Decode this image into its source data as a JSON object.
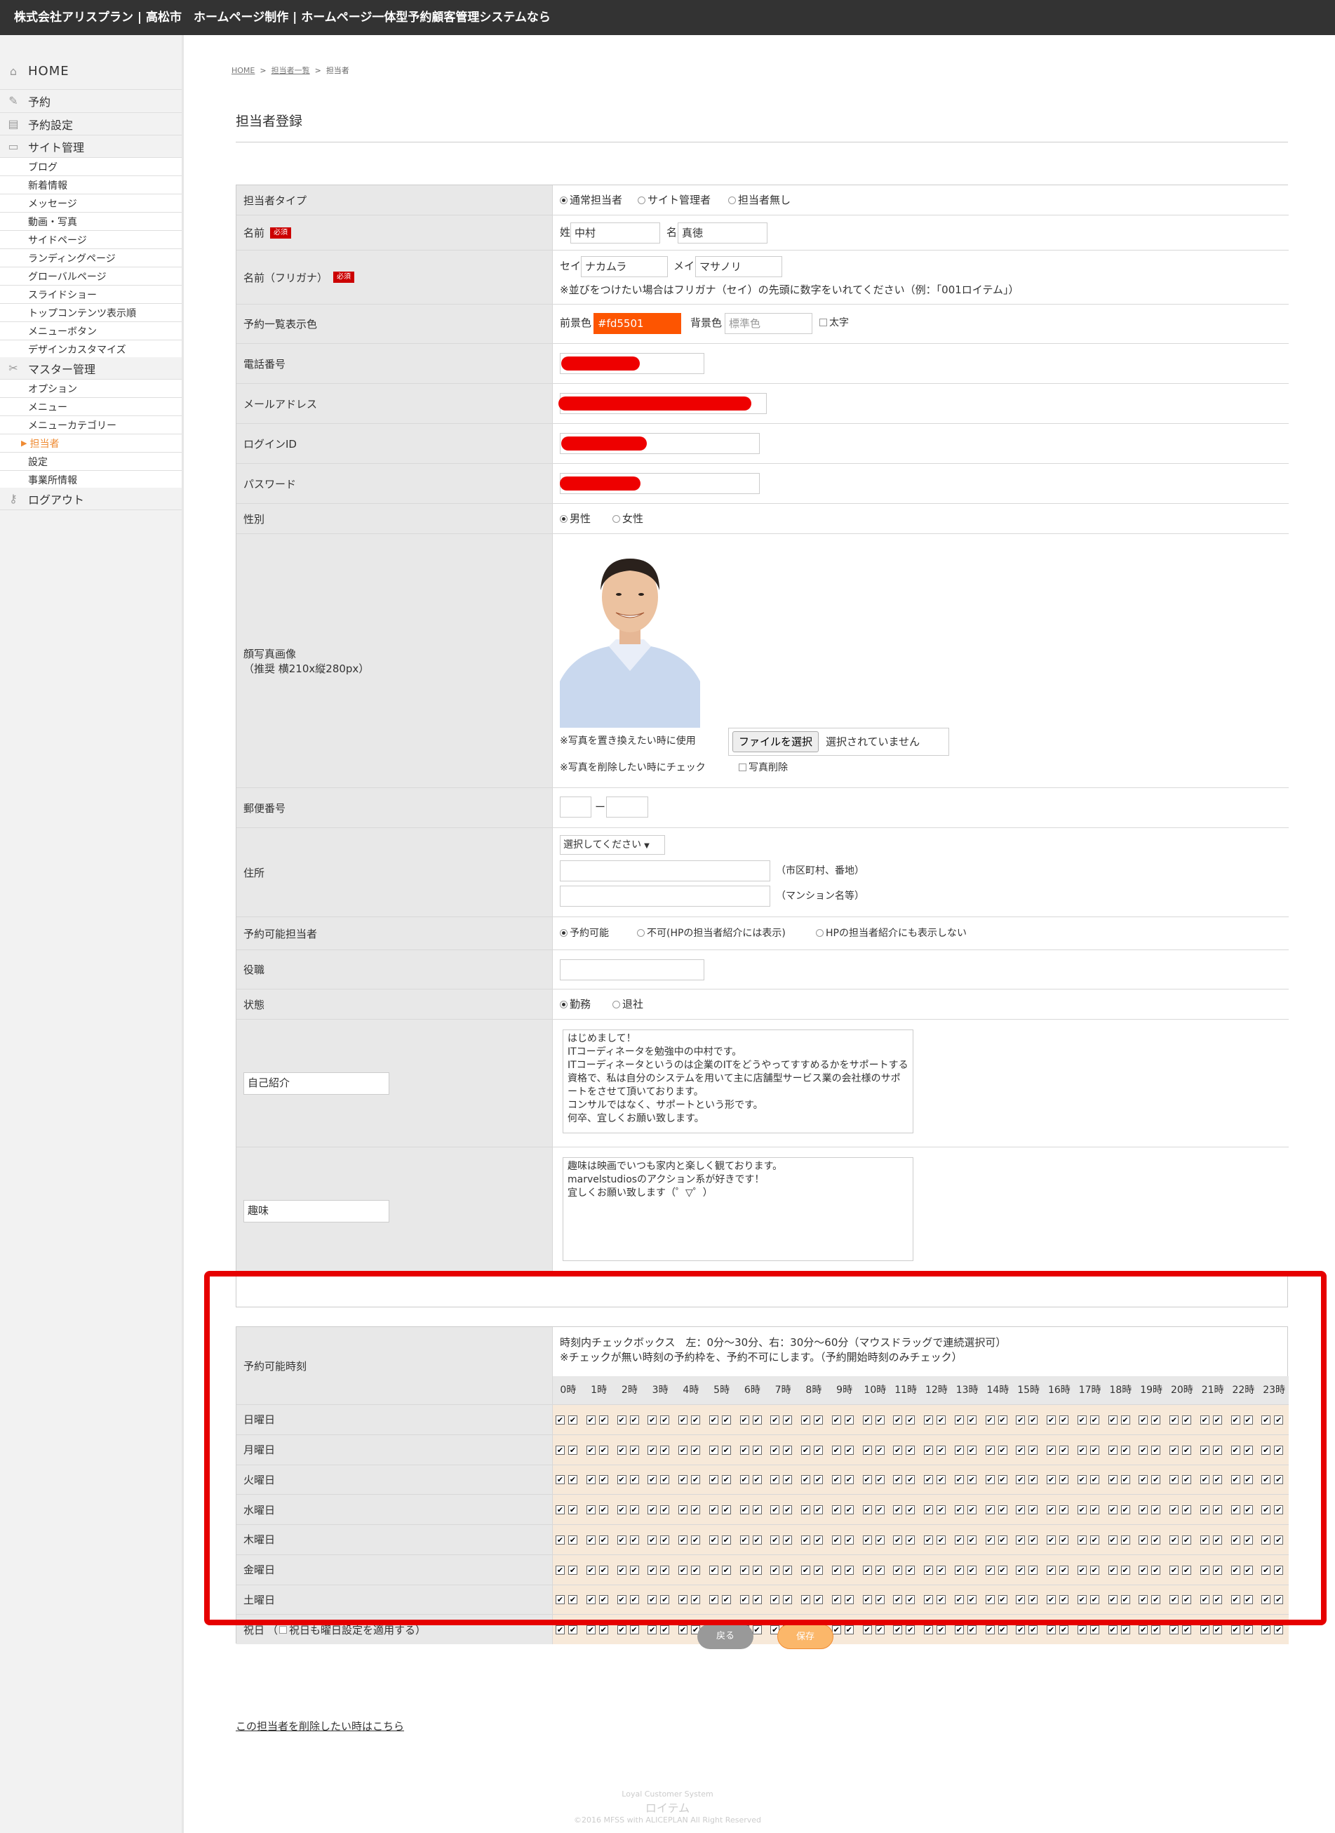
{
  "topbar": {
    "title": "株式会社アリスプラン | 高松市　ホームページ制作 | ホームページ一体型予約顧客管理システムなら"
  },
  "sidebar": {
    "home": "HOME",
    "reserve": "予約",
    "reserve_settings": "予約設定",
    "site_manage": "サイト管理",
    "site_items": [
      "ブログ",
      "新着情報",
      "メッセージ",
      "動画・写真",
      "サイドページ",
      "ランディングページ",
      "グローバルページ",
      "スライドショー",
      "トップコンテンツ表示順",
      "メニューボタン",
      "デザインカスタマイズ"
    ],
    "master_manage": "マスター管理",
    "master_items": [
      "オプション",
      "メニュー",
      "メニューカテゴリー",
      "担当者",
      "設定",
      "事業所情報"
    ],
    "logout": "ログアウト"
  },
  "breadcrumb": {
    "home": "HOME",
    "list": "担当者一覧",
    "current": "担当者"
  },
  "page_title": "担当者登録",
  "form": {
    "staff_type": {
      "label": "担当者タイプ",
      "options": [
        "通常担当者",
        "サイト管理者",
        "担当者無し"
      ]
    },
    "name": {
      "label": "名前",
      "required": "必須",
      "sei_label": "姓",
      "sei": "中村",
      "mei_label": "名",
      "mei": "真徳"
    },
    "kana": {
      "label": "名前（フリガナ）",
      "required": "必須",
      "sei_label": "セイ",
      "sei": "ナカムラ",
      "mei_label": "メイ",
      "mei": "マサノリ",
      "note": "※並びをつけたい場合はフリガナ（セイ）の先頭に数字をいれてください（例：「001ロイテム」）"
    },
    "color": {
      "label": "予約一覧表示色",
      "fg_label": "前景色",
      "fg": "#fd5501",
      "bg_label": "背景色",
      "bg_placeholder": "標準色",
      "bold": "太字"
    },
    "phone": {
      "label": "電話番号"
    },
    "email": {
      "label": "メールアドレス"
    },
    "login": {
      "label": "ログインID"
    },
    "password": {
      "label": "パスワード"
    },
    "gender": {
      "label": "性別",
      "options": [
        "男性",
        "女性"
      ]
    },
    "photo": {
      "label": "顔写真画像",
      "sublabel": "（推奨 横210x縦280px）",
      "replace_note": "※写真を置き換えたい時に使用",
      "file_btn": "ファイルを選択",
      "file_status": "選択されていません",
      "delete_note": "※写真を削除したい時にチェック",
      "delete_label": "写真削除"
    },
    "postal": {
      "label": "郵便番号",
      "dash": "ー"
    },
    "address": {
      "label": "住所",
      "pref": "選択してください",
      "city_note": "（市区町村、番地）",
      "building_note": "（マンション名等）"
    },
    "reservable": {
      "label": "予約可能担当者",
      "options": [
        "予約可能",
        "不可(HPの担当者紹介には表示)",
        "HPの担当者紹介にも表示しない"
      ]
    },
    "position": {
      "label": "役職"
    },
    "status": {
      "label": "状態",
      "options": [
        "勤務",
        "退社"
      ]
    },
    "intro": {
      "label": "自己紹介",
      "text": "はじめまして！\nITコーディネータを勉強中の中村です。\nITコーディネータというのは企業のITをどうやってすすめるかをサポートする資格で、私は自分のシステムを用いて主に店舗型サービス業の会社様のサポートをさせて頂いております。\nコンサルではなく、サポートという形です。\n何卒、宜しくお願い致します。"
    },
    "hobby": {
      "label": "趣味",
      "text": "趣味は映画でいつも家内と楽しく観ております。\nmarvelstudiosのアクション系が好きです！\n宜しくお願い致します（゜▽゜）"
    }
  },
  "schedule": {
    "label": "予約可能時刻",
    "note1": "時刻内チェックボックス　左：0分〜30分、右：30分〜60分（マウスドラッグで連続選択可）",
    "note2": "※チェックが無い時刻の予約枠を、予約不可にします。（予約開始時刻のみチェック）",
    "hours": [
      "0時",
      "1時",
      "2時",
      "3時",
      "4時",
      "5時",
      "6時",
      "7時",
      "8時",
      "9時",
      "10時",
      "11時",
      "12時",
      "13時",
      "14時",
      "15時",
      "16時",
      "17時",
      "18時",
      "19時",
      "20時",
      "21時",
      "22時",
      "23時"
    ],
    "days": [
      "日曜日",
      "月曜日",
      "火曜日",
      "水曜日",
      "木曜日",
      "金曜日",
      "土曜日",
      "祝日"
    ],
    "holiday_check": "祝日も曜日設定を適用する）",
    "holiday_open": "（"
  },
  "buttons": {
    "back": "戻る",
    "save": "保存"
  },
  "delete_link": "この担当者を削除したい時はこちら",
  "footer": {
    "line1": "Loyal Customer System",
    "line2": "ロイテム",
    "line3": "©2016 MFSS with ALICEPLAN All Right Reserved"
  },
  "colors": {
    "accent": "#ef8b33",
    "fg_swatch": "#fd5501",
    "highlight": "#e60000"
  }
}
